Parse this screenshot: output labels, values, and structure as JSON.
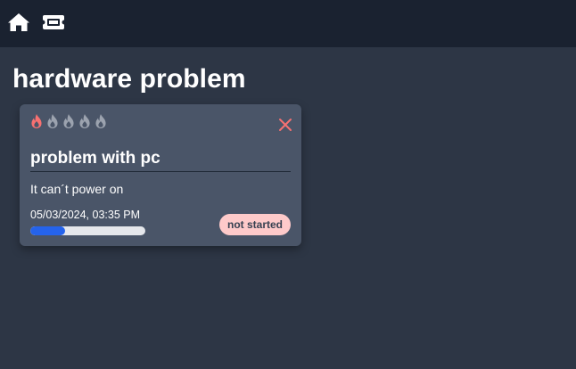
{
  "nav": {
    "items": [
      {
        "icon": "home-icon"
      },
      {
        "icon": "ticket-icon"
      }
    ]
  },
  "page": {
    "title": "hardware problem"
  },
  "ticket": {
    "priority": {
      "level": 1,
      "max": 5,
      "active_color": "#f87171",
      "inactive_color": "#9ca3af",
      "icon": "flame-icon"
    },
    "title": "problem with pc",
    "description": "It can´t power on",
    "timestamp": "05/03/2024, 03:35 PM",
    "progress_fraction": 0.3,
    "status": "not started",
    "close_icon": "close-icon"
  },
  "colors": {
    "accent": "#2563eb",
    "close": "#f87171",
    "status_badge_bg": "#fecaca"
  }
}
